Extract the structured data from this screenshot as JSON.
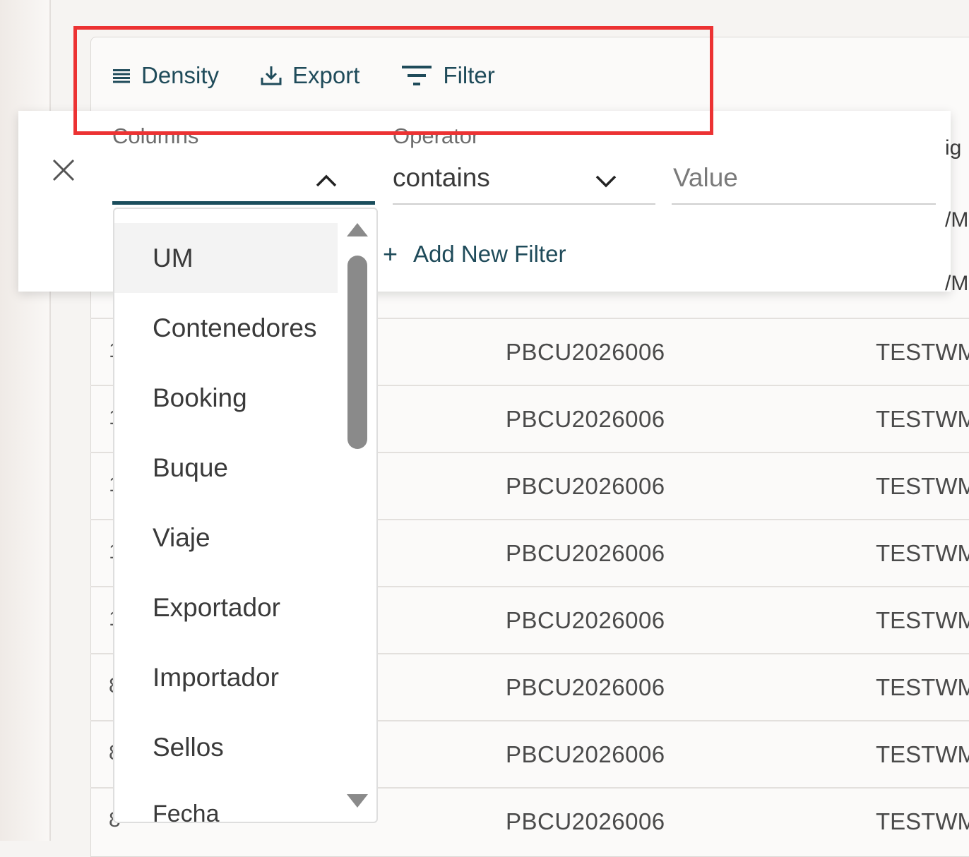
{
  "toolbar": {
    "density_label": "Density",
    "export_label": "Export",
    "filter_label": "Filter"
  },
  "filter_panel": {
    "columns_label": "Columns",
    "operator_label": "Operator",
    "operator_value": "contains",
    "value_placeholder": "Value",
    "add_filter_label": "Add New Filter",
    "add_filter_icon": "+"
  },
  "column_options": {
    "selected": "UM",
    "items": [
      "UM",
      "Contenedores",
      "Booking",
      "Buque",
      "Viaje",
      "Exportador",
      "Importador",
      "Sellos",
      "Fecha"
    ]
  },
  "table": {
    "rows": [
      {
        "stub": "1",
        "container": "PBCU2026006",
        "user": "TESTWM"
      },
      {
        "stub": "1",
        "container": "PBCU2026006",
        "user": "TESTWM"
      },
      {
        "stub": "1",
        "container": "PBCU2026006",
        "user": "TESTWM"
      },
      {
        "stub": "1",
        "container": "PBCU2026006",
        "user": "TESTWM"
      },
      {
        "stub": "1",
        "container": "PBCU2026006",
        "user": "TESTWM"
      },
      {
        "stub": "8",
        "container": "PBCU2026006",
        "user": "TESTWM"
      },
      {
        "stub": "8",
        "container": "PBCU2026006",
        "user": "TESTWM"
      },
      {
        "stub": "8",
        "container": "PBCU2026006",
        "user": "TESTWM"
      }
    ],
    "edge_header_fragment": "ig",
    "edge_row_fragment_1": "/M",
    "edge_row_fragment_2": "/M"
  },
  "colors": {
    "accent": "#1f4b5a",
    "highlight": "#ec3233"
  },
  "icons": {
    "density": "density-lines-icon",
    "export": "download-tray-icon",
    "filter": "filter-funnel-icon",
    "close": "close-icon",
    "chevron_up": "chevron-up-icon",
    "chevron_down": "chevron-down-icon"
  }
}
